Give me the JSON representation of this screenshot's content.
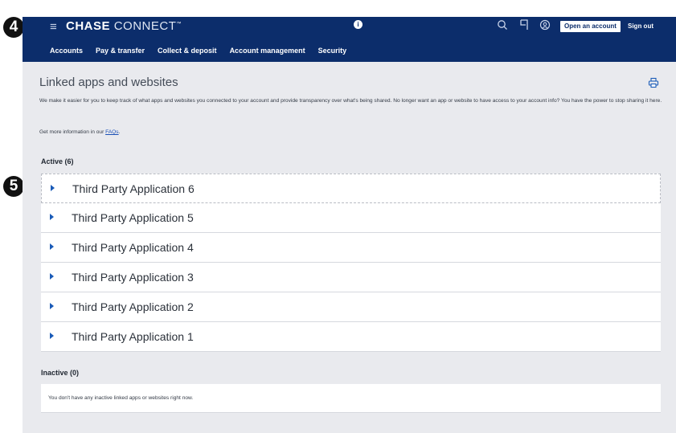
{
  "steps": {
    "top": "4",
    "apps": "5"
  },
  "header": {
    "menu_glyph": "≡",
    "brand_bold": "CHASE",
    "brand_light": "CONNECT",
    "brand_tm": "™",
    "info_glyph": "i",
    "open_account": "Open an account",
    "sign_out": "Sign out",
    "icons": [
      "search-icon",
      "bookmark-icon",
      "profile-icon",
      "info-icon",
      "menu-icon"
    ]
  },
  "nav": {
    "items": [
      "Accounts",
      "Pay & transfer",
      "Collect & deposit",
      "Account management",
      "Security"
    ]
  },
  "page": {
    "title": "Linked apps and websites",
    "description": "We make it easier for you to keep track of what apps and websites you connected to your account and provide transparency over what's being shared. No longer want an app or website to have access to your account info? You have the power to stop sharing it here.",
    "faq_prefix": "Get more information in our ",
    "faq_link": "FAQs",
    "faq_suffix": ".",
    "print_icon": "printer-icon"
  },
  "active": {
    "heading": "Active (6)",
    "apps": [
      "Third Party Application 6",
      "Third Party Application 5",
      "Third Party Application 4",
      "Third Party Application 3",
      "Third Party Application 2",
      "Third Party Application 1"
    ]
  },
  "inactive": {
    "heading": "Inactive (0)",
    "message": "You don't have any inactive linked apps or websites right now."
  },
  "colors": {
    "header_bg": "#0c2d6b",
    "page_bg": "#e9eaee",
    "accent": "#1a5bb8"
  }
}
